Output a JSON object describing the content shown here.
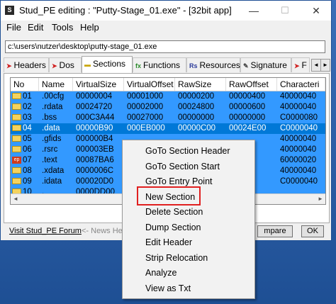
{
  "window": {
    "title": "Stud_PE editing : \"Putty-Stage_01.exe\" - [32bit app]",
    "app_icon_glyph": "S",
    "minimize_glyph": "—",
    "maximize_glyph": "☐",
    "close_glyph": "✕"
  },
  "menu": [
    "File",
    "Edit",
    "Tools",
    "Help"
  ],
  "path": "c:\\users\\nutzer\\desktop\\putty-stage_01.exe",
  "tabs": [
    {
      "label": "Headers",
      "icon": "red-arrow-icon",
      "glyph": "➤",
      "color": "#d02020"
    },
    {
      "label": "Dos",
      "icon": "red-arrow-icon",
      "glyph": "➤",
      "color": "#d02020"
    },
    {
      "label": "Sections",
      "icon": "folder-icon",
      "glyph": "▬",
      "color": "#c9a60c"
    },
    {
      "label": "Functions",
      "icon": "fx-icon",
      "glyph": "fx",
      "color": "#2a8a2a"
    },
    {
      "label": "Resources",
      "icon": "rs-icon",
      "glyph": "Rs",
      "color": "#2a3a9a"
    },
    {
      "label": "Signature",
      "icon": "signature-icon",
      "glyph": "✎",
      "color": "#444444"
    },
    {
      "label": "F",
      "icon": "red-arrow-icon",
      "glyph": "➤",
      "color": "#d02020"
    }
  ],
  "tab_scroll": {
    "left": "◄",
    "right": "►"
  },
  "table": {
    "columns": [
      "No",
      "Name",
      "VirtualSize",
      "VirtualOffset",
      "RawSize",
      "RawOffset",
      "Characteri"
    ],
    "rows": [
      [
        "01",
        ".00cfg",
        "00000004",
        "00001000",
        "00000200",
        "00000400",
        "40000040"
      ],
      [
        "02",
        ".rdata",
        "00024720",
        "00002000",
        "00024800",
        "00000600",
        "40000040"
      ],
      [
        "03",
        ".bss",
        "000C3A44",
        "00027000",
        "00000000",
        "00000000",
        "C0000080"
      ],
      [
        "04",
        ".data",
        "00000B90",
        "000EB000",
        "00000C00",
        "00024E00",
        "C0000040"
      ],
      [
        "05",
        ".gfids",
        "000000B4",
        "",
        "",
        "",
        "40000040"
      ],
      [
        "06",
        ".rsrc",
        "000003EB",
        "",
        "",
        "",
        "40000040"
      ],
      [
        "07",
        ".text",
        "00087BA6",
        "",
        "",
        "",
        "60000020"
      ],
      [
        "08",
        ".xdata",
        "0000006C",
        "",
        "",
        "",
        "40000040"
      ],
      [
        "09",
        ".idata",
        "000020D0",
        "",
        "",
        "",
        "C0000040"
      ],
      [
        "10",
        ".",
        "0000DD00",
        "",
        "",
        "",
        ""
      ]
    ],
    "selected_row": "04",
    "row_icon_color": "#f4d35e",
    "row07_icon": "ep-icon"
  },
  "bottom": {
    "forum_link": "Visit Stud_PE Forum",
    "news": "<- News Here",
    "compare_button": "mpare",
    "ok_button": "OK"
  },
  "context_menu": [
    "GoTo Section Header",
    "GoTo Section Start",
    "GoTo Entry Point",
    "New Section",
    "Delete Section",
    "Dump Section",
    "Edit Header",
    "Strip Relocation",
    "Analyze",
    "View as Txt"
  ],
  "highlighted_menu_item": "New Section",
  "colors": {
    "selection": "#0078d7",
    "row_bg": "#3399ff",
    "highlight_box": "#e02020"
  }
}
